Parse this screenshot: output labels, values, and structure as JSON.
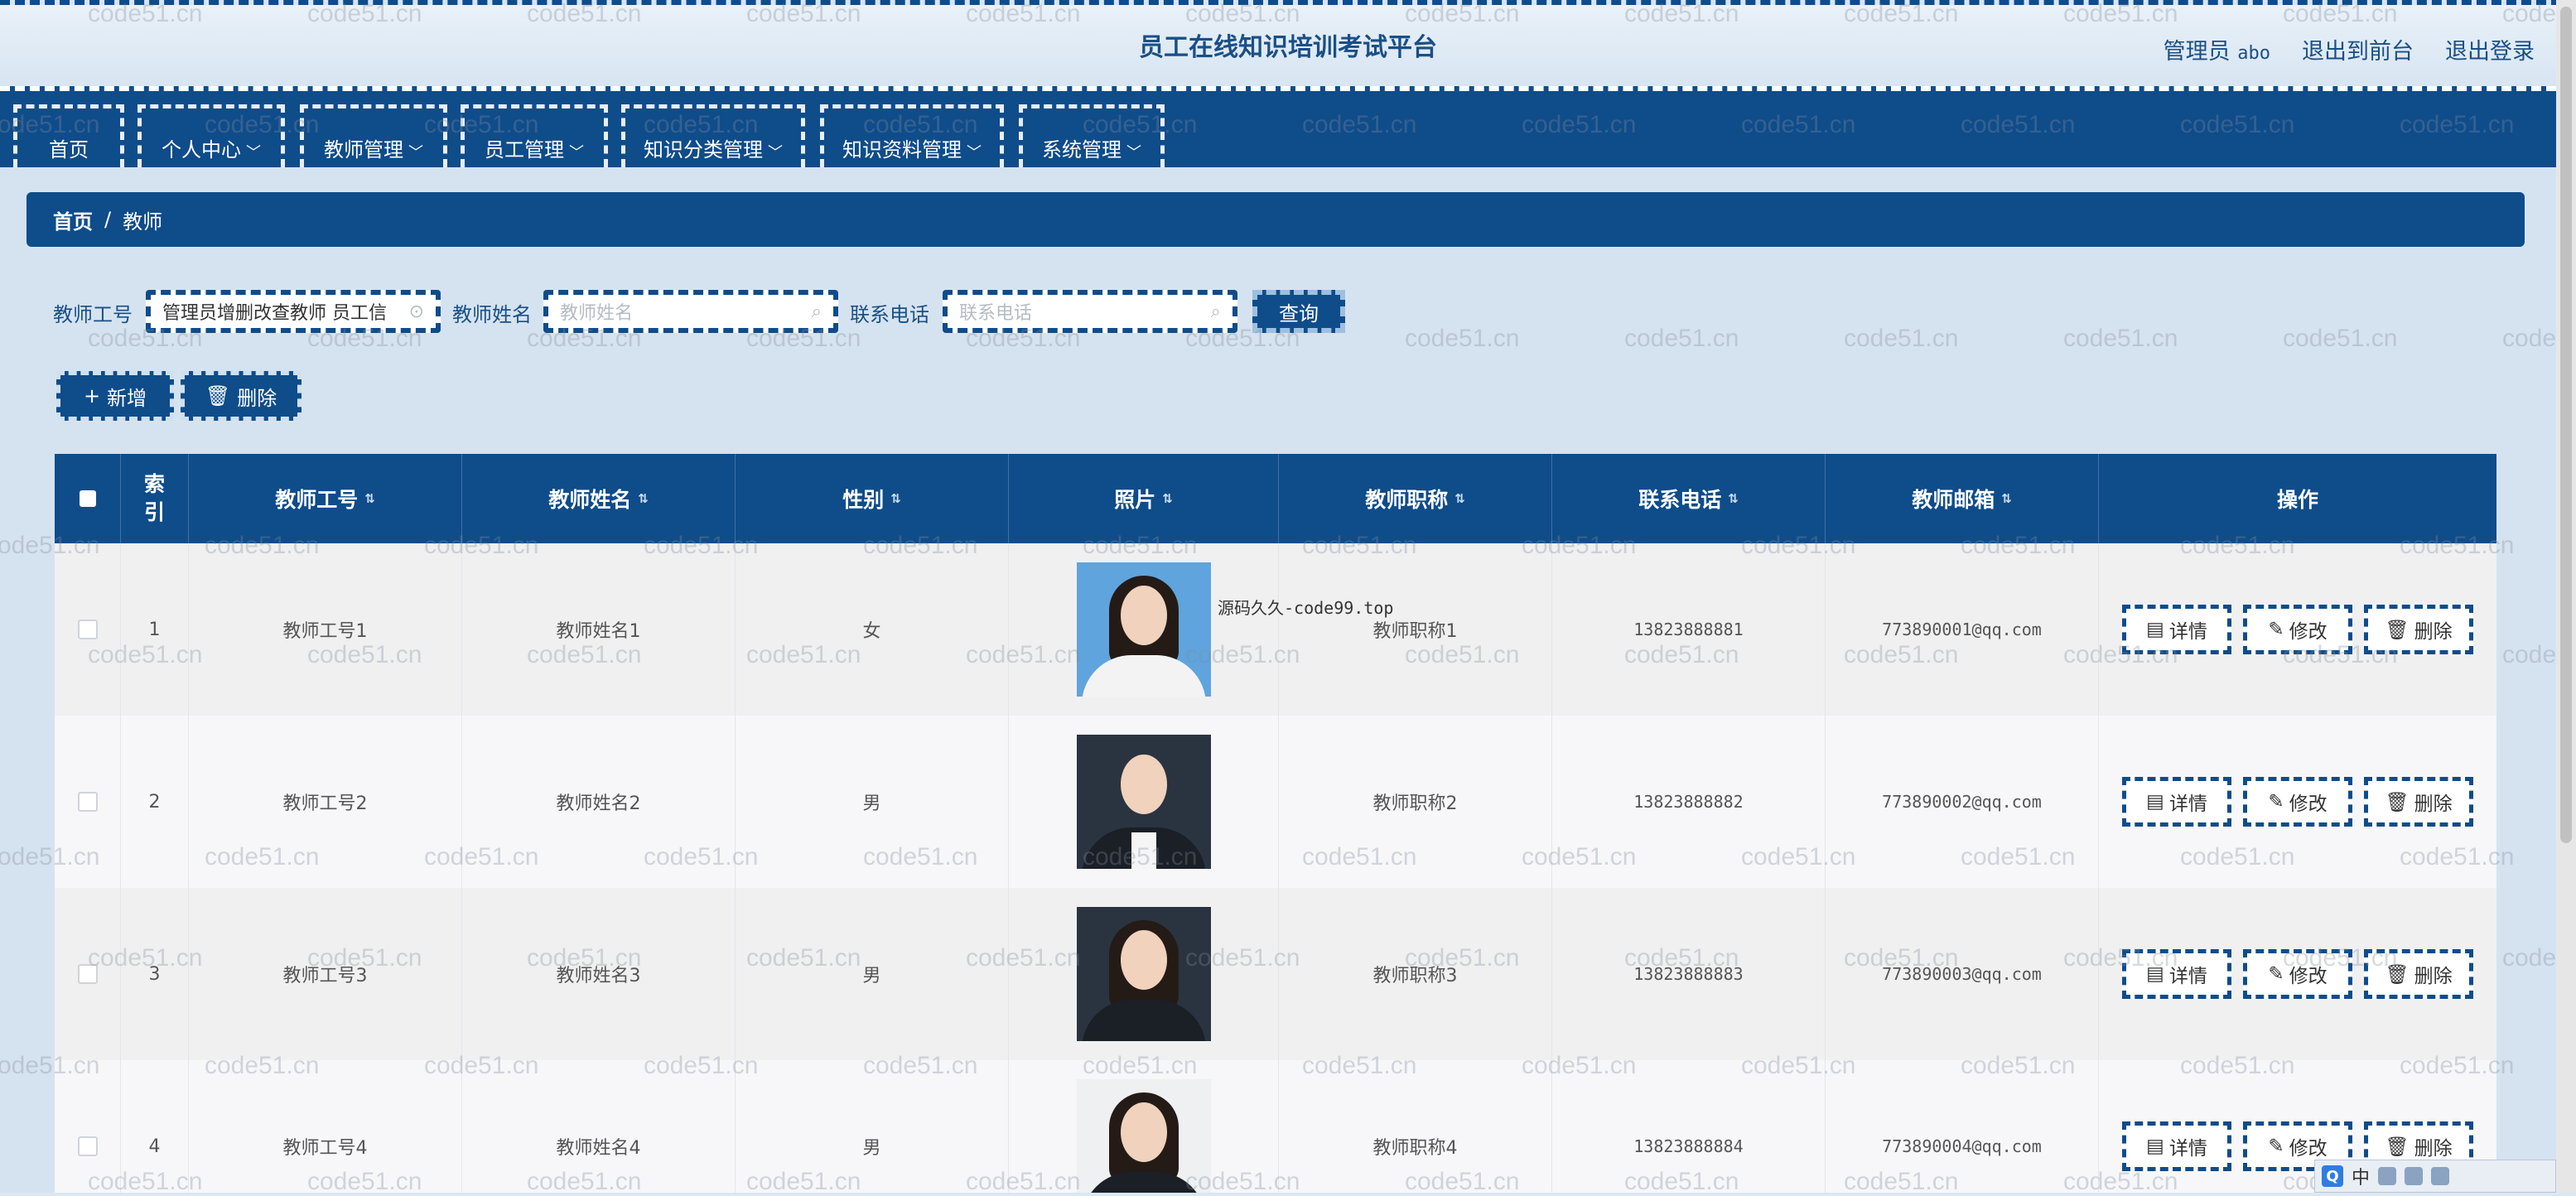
{
  "header": {
    "title": "员工在线知识培训考试平台",
    "user_role": "管理员",
    "user_name": "abo",
    "back_to_front": "退出到前台",
    "logout": "退出登录"
  },
  "nav": [
    {
      "label": "首页",
      "chevron": ""
    },
    {
      "label": "个人中心",
      "chevron": "﹀"
    },
    {
      "label": "教师管理",
      "chevron": "﹀"
    },
    {
      "label": "员工管理",
      "chevron": "﹀"
    },
    {
      "label": "知识分类管理",
      "chevron": "﹀"
    },
    {
      "label": "知识资料管理",
      "chevron": "﹀"
    },
    {
      "label": "系统管理",
      "chevron": "﹀"
    }
  ],
  "breadcrumb": {
    "home": "首页",
    "separator": "/",
    "current": "教师"
  },
  "search": {
    "teacher_no_label": "教师工号",
    "teacher_no_value": "管理员增删改查教师 员工信",
    "teacher_name_label": "教师姓名",
    "teacher_name_placeholder": "教师姓名",
    "phone_label": "联系电话",
    "phone_placeholder": "联系电话",
    "query_label": "查询"
  },
  "actions": {
    "add_label": "新增",
    "add_icon": "+",
    "delete_label": "删除",
    "delete_icon": "🗑"
  },
  "table": {
    "headers": [
      "",
      "索引",
      "教师工号",
      "教师姓名",
      "性别",
      "照片",
      "教师职称",
      "联系电话",
      "教师邮箱",
      "操作"
    ],
    "sort_glyph": "⇅",
    "rows": [
      {
        "index": "1",
        "teacher_no": "教师工号1",
        "name": "教师姓名1",
        "gender": "女",
        "title": "教师职称1",
        "phone": "13823888881",
        "email": "773890001@qq.com",
        "photo": "woman-white-shirt"
      },
      {
        "index": "2",
        "teacher_no": "教师工号2",
        "name": "教师姓名2",
        "gender": "男",
        "title": "教师职称2",
        "phone": "13823888882",
        "email": "773890002@qq.com",
        "photo": "man-dark-suit"
      },
      {
        "index": "3",
        "teacher_no": "教师工号3",
        "name": "教师姓名3",
        "gender": "男",
        "title": "教师职称3",
        "phone": "13823888883",
        "email": "773890003@qq.com",
        "photo": "woman-dark-suit"
      },
      {
        "index": "4",
        "teacher_no": "教师工号4",
        "name": "教师姓名4",
        "gender": "男",
        "title": "教师职称4",
        "phone": "13823888884",
        "email": "773890004@qq.com",
        "photo": "woman-dark-suit"
      }
    ],
    "op_detail": "详情",
    "op_edit": "修改",
    "op_delete": "删除"
  },
  "photo_caption": "源码久久-code99.top",
  "watermark_text": "code51.cn",
  "tray": {
    "q": "Q",
    "ime": "中"
  },
  "colors": {
    "primary": "#0f4c8a",
    "background": "#d5e3f0"
  }
}
